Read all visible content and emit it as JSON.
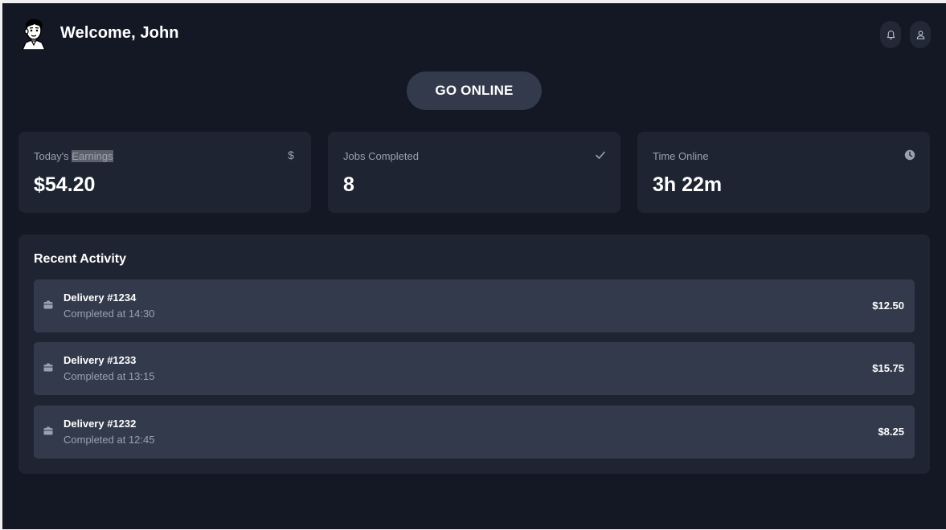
{
  "header": {
    "welcome": "Welcome, John",
    "avatar_icon": "cartoon-face-avatar",
    "bell_icon": "bell-icon",
    "user_icon": "user-icon"
  },
  "go_online_label": "GO ONLINE",
  "stats": [
    {
      "label_plain": "Today's ",
      "label_highlight": "Earnings",
      "value": "$54.20",
      "icon": "dollar-icon"
    },
    {
      "label": "Jobs Completed",
      "value": "8",
      "icon": "check-icon"
    },
    {
      "label": "Time Online",
      "value": "3h 22m",
      "icon": "clock-icon"
    }
  ],
  "activity": {
    "title": "Recent Activity",
    "rows": [
      {
        "title": "Delivery #1234",
        "subtitle": "Completed at 14:30",
        "amount": "$12.50",
        "icon": "package-icon"
      },
      {
        "title": "Delivery #1233",
        "subtitle": "Completed at 13:15",
        "amount": "$15.75",
        "icon": "package-icon"
      },
      {
        "title": "Delivery #1232",
        "subtitle": "Completed at 12:45",
        "amount": "$8.25",
        "icon": "package-icon"
      }
    ]
  },
  "colors": {
    "background": "#131824",
    "card": "#1f2432",
    "button": "#333a4b",
    "muted_text": "#9aa1b0"
  }
}
